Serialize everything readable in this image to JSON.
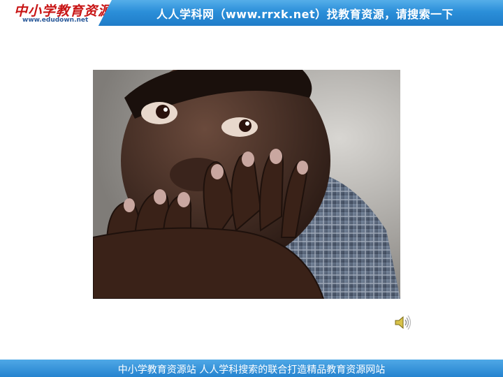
{
  "header": {
    "logo_title": "中小学教育资源",
    "logo_url": "www.edudown.net",
    "slogan": "人人学科网（www.rrxk.net）找教育资源，请搜索一下"
  },
  "photo": {
    "icon": "photo-child-hands"
  },
  "audio": {
    "icon": "speaker-icon"
  },
  "footer": {
    "text": "中小学教育资源站 人人学科搜索的联合打造精品教育资源网站"
  },
  "colors": {
    "banner_blue": "#2b8fd9",
    "logo_red": "#c81414",
    "background": "#ffffff"
  }
}
